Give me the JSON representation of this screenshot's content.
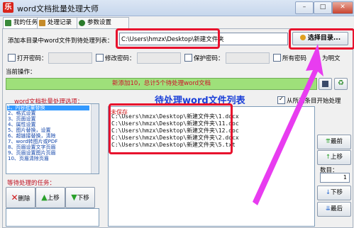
{
  "window": {
    "title": "word文档批量处理大师",
    "app_icon": "乐"
  },
  "tabs": [
    {
      "label": "我的任务"
    },
    {
      "label": "处理记录"
    },
    {
      "label": "参数设置"
    }
  ],
  "directory": {
    "label": "添加本目录中word文件到待处理列表：",
    "path": "C:\\Users\\hmzx\\Desktop\\新建文件夹",
    "select_button": "选择目录..."
  },
  "passwords": {
    "open_label": "打开密码：",
    "modify_label": "修改密码：",
    "protect_label": "保护密码：",
    "all_readonly_label": "所有密码",
    "plaintext_label": "为明文"
  },
  "current_op": {
    "label": "当前操作：",
    "status": "新添加10，总计5个待处理word文档"
  },
  "options": {
    "title": "word文档批量处理选项：",
    "items": [
      "1、内容批量替换",
      "2、格式设置",
      "3、页面设置",
      "4、属性设置",
      "5、图片替换，设置",
      "6、超链接替换，清除",
      "7、word转图片或PDF",
      "8、页眉设置文字页眉",
      "9、页眉设置图片页眉",
      "10、页眉清除页眉"
    ]
  },
  "pending": {
    "title": "待处理word文件列表",
    "auto_process_label": "从所选条目开始处理",
    "list_header": "未保存",
    "files": [
      "C:\\Users\\hmzx\\Desktop\\新建文件夹\\1.docx",
      "C:\\Users\\hmzx\\Desktop\\新建文件夹\\11.doc",
      "C:\\Users\\hmzx\\Desktop\\新建文件夹\\12.doc",
      "C:\\Users\\hmzx\\Desktop\\新建文件夹\\2.docx",
      "C:\\Users\\hmzx\\Desktop\\新建文件夹\\5.txt"
    ]
  },
  "queue": {
    "title": "等待处理的任务：",
    "delete": "删除",
    "up": "上移",
    "down": "下移"
  },
  "side_buttons": {
    "top": "最前",
    "up": "上移",
    "count_label": "数目：",
    "count_value": "1",
    "down": "下移",
    "bottom": "最后"
  },
  "colors": {
    "highlight_red": "#e8112d",
    "annotation_magenta": "#e83cf0",
    "status_green": "#9ee07a",
    "title_blue": "#1a3fd8"
  }
}
